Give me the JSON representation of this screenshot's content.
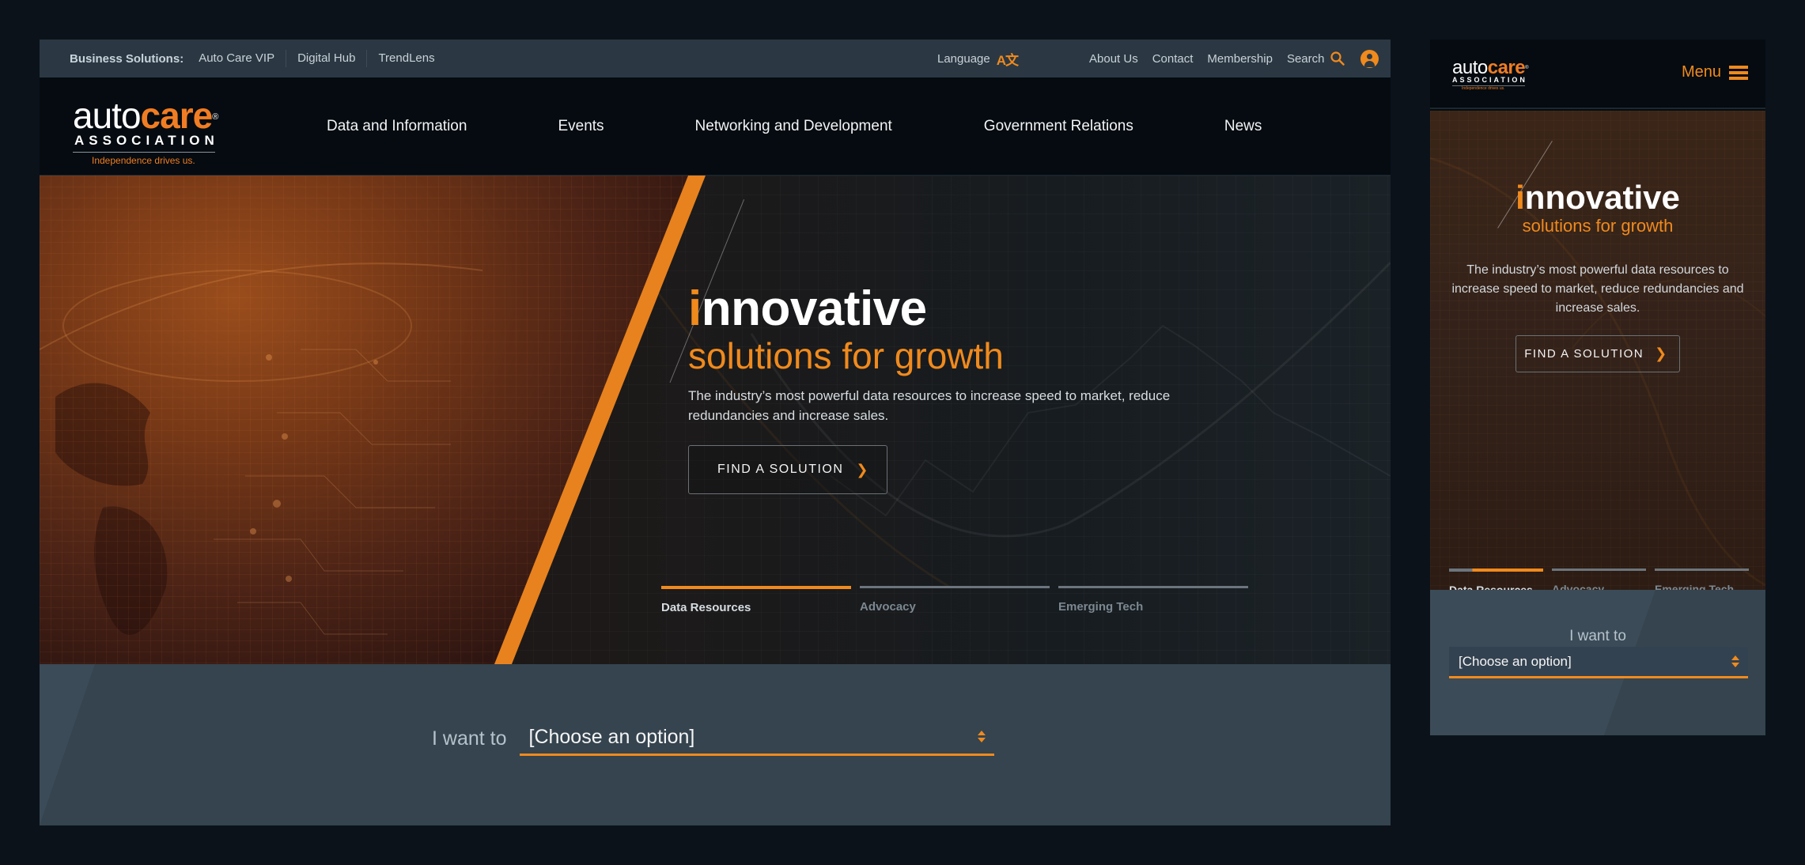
{
  "desktop": {
    "utility_bar": {
      "business_solutions_label": "Business Solutions:",
      "business_links": [
        "Auto Care VIP",
        "Digital Hub",
        "TrendLens"
      ],
      "language_label": "Language",
      "language_icon": "translate-icon",
      "language_glyph": "A文",
      "right_links": [
        "About Us",
        "Contact",
        "Membership"
      ],
      "search_label": "Search",
      "search_icon": "search-icon",
      "account_icon": "user-account-icon"
    },
    "logo": {
      "auto": "auto",
      "care": "care",
      "registered": "®",
      "association": "ASSOCIATION",
      "tagline": "Independence drives us."
    },
    "main_nav": [
      "Data and Information",
      "Events",
      "Networking and Development",
      "Government Relations",
      "News"
    ],
    "hero": {
      "title_first_letter": "i",
      "title_rest": "nnovative",
      "subtitle": "solutions for growth",
      "description": "The industry’s most powerful data resources to increase speed to market, reduce redundancies and increase sales.",
      "cta_label": "FIND A SOLUTION",
      "cta_icon": "chevron-right-icon",
      "cta_glyph": "❯",
      "tabs": [
        {
          "label": "Data Resources",
          "active": true
        },
        {
          "label": "Advocacy",
          "active": false
        },
        {
          "label": "Emerging Tech",
          "active": false
        }
      ]
    },
    "want": {
      "label": "I want to",
      "select_value": "[Choose an option]"
    }
  },
  "mobile": {
    "logo": {
      "auto": "auto",
      "care": "care",
      "registered": "®",
      "association": "ASSOCIATION",
      "tagline": "Independence drives us."
    },
    "menu_label": "Menu",
    "hero": {
      "title_first_letter": "i",
      "title_rest": "nnovative",
      "subtitle": "solutions for growth",
      "description": "The industry’s most powerful data resources to increase speed to market, reduce redundancies and increase sales.",
      "cta_label": "FIND A SOLUTION",
      "cta_glyph": "❯",
      "tabs": [
        {
          "label": "Data Resources",
          "active": true,
          "progress": 0.75
        },
        {
          "label": "Advocacy",
          "active": false
        },
        {
          "label": "Emerging Tech",
          "active": false
        }
      ]
    },
    "want": {
      "label": "I want to",
      "select_value": "[Choose an option]"
    }
  },
  "colors": {
    "accent": "#f08a1d",
    "utility_bar": "#2b3843",
    "header_bg": "#050b10",
    "want_section": "#35444f",
    "page_bg": "#0b121a"
  }
}
